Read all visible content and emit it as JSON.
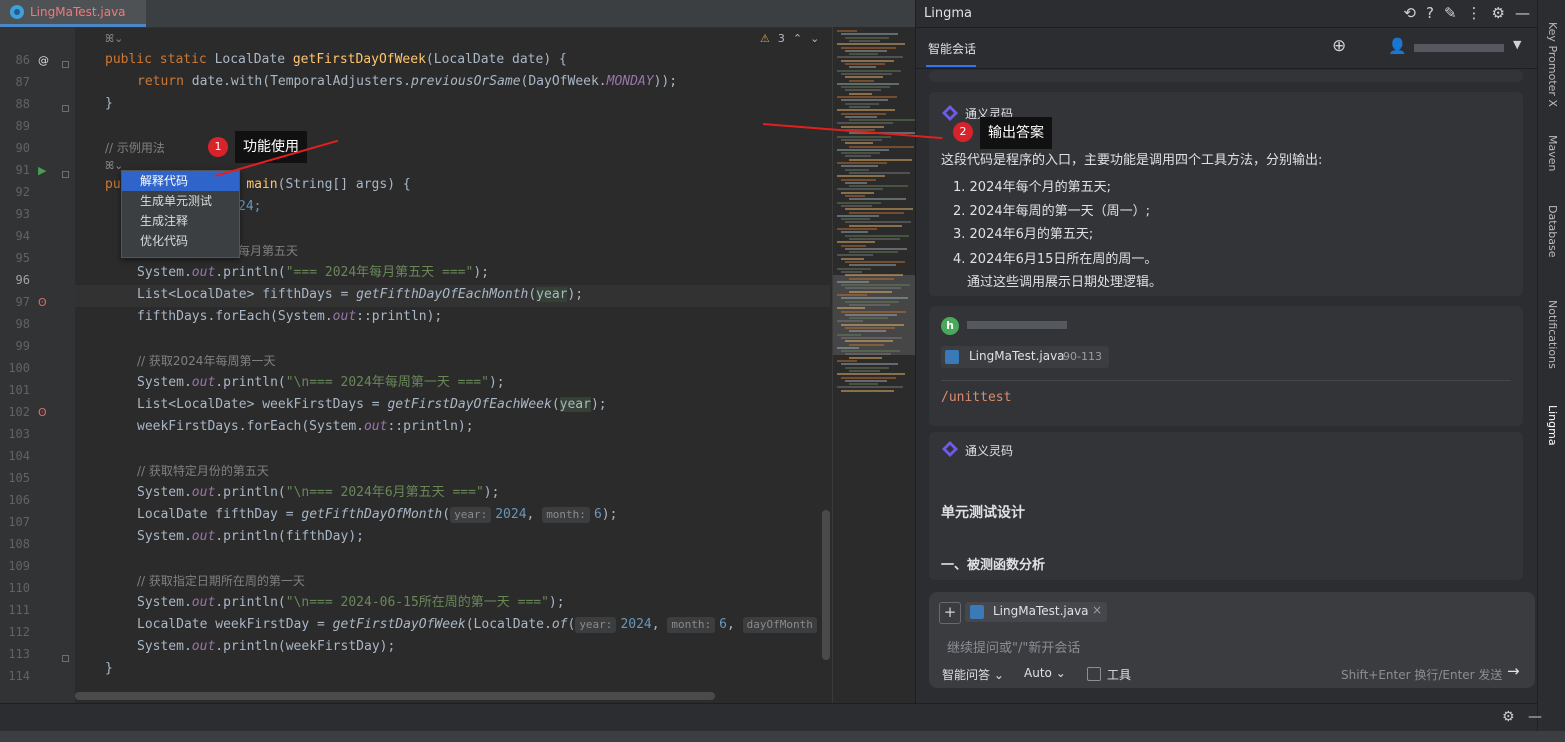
{
  "editor": {
    "tab_label": "LingMaTest.java",
    "warnings_count": "3",
    "lines": [
      {
        "no": "86"
      },
      {
        "no": "87"
      },
      {
        "no": "88"
      },
      {
        "no": "89"
      },
      {
        "no": "90"
      },
      {
        "no": "91"
      },
      {
        "no": "92"
      },
      {
        "no": "93"
      },
      {
        "no": "94"
      },
      {
        "no": "95"
      },
      {
        "no": "96"
      },
      {
        "no": "97"
      },
      {
        "no": "98"
      },
      {
        "no": "99"
      },
      {
        "no": "100"
      },
      {
        "no": "101"
      },
      {
        "no": "102"
      },
      {
        "no": "103"
      },
      {
        "no": "104"
      },
      {
        "no": "105"
      },
      {
        "no": "106"
      },
      {
        "no": "107"
      },
      {
        "no": "108"
      },
      {
        "no": "109"
      },
      {
        "no": "110"
      },
      {
        "no": "111"
      },
      {
        "no": "112"
      },
      {
        "no": "113"
      },
      {
        "no": "114"
      }
    ],
    "code": {
      "l86_kw": "public static ",
      "l86_type": "LocalDate ",
      "l86_fn": "getFirstDayOfWeek",
      "l86_rest": "(LocalDate date) {",
      "l87_kw": "return ",
      "l87_a": "date.with(TemporalAdjusters.",
      "l87_it": "previousOrSame",
      "l87_b": "(DayOfWeek.",
      "l87_c": "MONDAY",
      "l87_d": "));",
      "l88": "}",
      "l90": "// 示例用法",
      "l91_kw": "pu",
      "l91_b": "d ",
      "l91_fn": "main",
      "l91_c": "(String[] args) {",
      "l92": "24;",
      "l94": "每月第五天",
      "l95_a": "System.",
      "l95_out": "out",
      "l95_b": ".println(",
      "l95_s": "\"=== 2024年每月第五天 ===\"",
      "l95_c": ");",
      "l96_a": "List<LocalDate> fifthDays = ",
      "l96_it": "getFifthDayOfEachMonth",
      "l96_b": "(",
      "l96_y": "year",
      "l96_c": ");",
      "l97_a": "fifthDays.forEach(System.",
      "l97_out": "out",
      "l97_b": "::println);",
      "l99": "// 获取2024年每周第一天",
      "l100_a": "System.",
      "l100_out": "out",
      "l100_b": ".println(",
      "l100_s": "\"\\n=== 2024年每周第一天 ===\"",
      "l100_c": ");",
      "l101_a": "List<LocalDate> weekFirstDays = ",
      "l101_it": "getFirstDayOfEachWeek",
      "l101_b": "(",
      "l101_y": "year",
      "l101_c": ");",
      "l102_a": "weekFirstDays.forEach(System.",
      "l102_out": "out",
      "l102_b": "::println);",
      "l104": "// 获取特定月份的第五天",
      "l105_a": "System.",
      "l105_out": "out",
      "l105_b": ".println(",
      "l105_s": "\"\\n=== 2024年6月第五天 ===\"",
      "l105_c": ");",
      "l106_a": "LocalDate fifthDay = ",
      "l106_it": "getFifthDayOfMonth",
      "l106_b": "(",
      "l106_h1": "year:",
      "l106_n1": "2024",
      "l106_c": ", ",
      "l106_h2": "month:",
      "l106_n2": "6",
      "l106_d": ");",
      "l107_a": "System.",
      "l107_out": "out",
      "l107_b": ".println(fifthDay);",
      "l109": "// 获取指定日期所在周的第一天",
      "l110_a": "System.",
      "l110_out": "out",
      "l110_b": ".println(",
      "l110_s": "\"\\n=== 2024-06-15所在周的第一天 ===\"",
      "l110_c": ");",
      "l111_a": "LocalDate weekFirstDay = ",
      "l111_it": "getFirstDayOfWeek",
      "l111_b": "(LocalDate.",
      "l111_of": "of",
      "l111_c": "(",
      "l111_h1": "year:",
      "l111_n1": "2024",
      "l111_d": ", ",
      "l111_h2": "month:",
      "l111_n2": "6",
      "l111_e": ", ",
      "l111_h3": "dayOfMonth",
      "l112_a": "System.",
      "l112_out": "out",
      "l112_b": ".println(weekFirstDay);",
      "l113": "}"
    },
    "popup_items": [
      "解释代码",
      "生成单元测试",
      "生成注释",
      "优化代码"
    ],
    "callout1_badge": "1",
    "callout1_text": "功能使用"
  },
  "panel": {
    "title": "Lingma",
    "tab": "智能会话",
    "callout2_badge": "2",
    "callout2_text": "输出答案",
    "answer": {
      "bot_name": "通义灵码",
      "intro": "这段代码是程序的入口，主要功能是调用四个工具方法，分别输出:",
      "items": [
        "1. 2024年每个月的第五天;",
        "2. 2024年每周的第一天（周一）;",
        "3. 2024年6月的第五天;",
        "4. 2024年6月15日所在周的周一。"
      ],
      "outro": "通过这些调用展示日期处理逻辑。"
    },
    "user": {
      "avatar_letter": "h",
      "file_chip": "LingMaTest.java",
      "file_range": "90-113",
      "command": "/unittest"
    },
    "answer2": {
      "bot_name": "通义灵码",
      "heading": "单元测试设计",
      "subheading": "一、被测函数分析"
    },
    "input": {
      "file_chip": "LingMaTest.java",
      "placeholder": "继续提问或\"/\"新开会话",
      "mode": "智能问答",
      "model": "Auto",
      "tools_label": "工具",
      "hint": "Shift+Enter 换行/Enter 发送"
    }
  },
  "right_strip": [
    "Key Promoter X",
    "Maven",
    "Database",
    "Notifications",
    "Lingma"
  ]
}
